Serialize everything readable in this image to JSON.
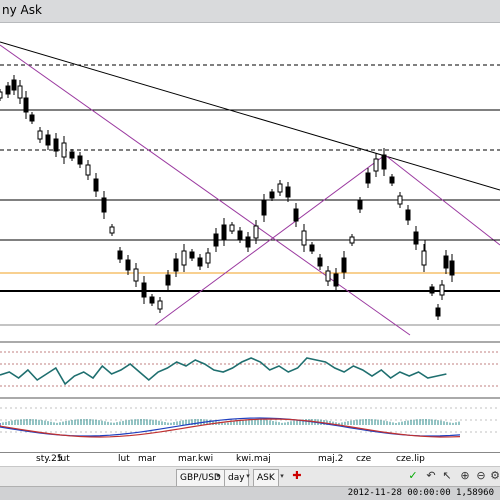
{
  "window": {
    "title": "ny Ask"
  },
  "chart": {
    "x_axis_labels": [
      "sty.25",
      "lut",
      "lut",
      "mar",
      "mar.kwi",
      "kwi.maj",
      "maj.2",
      "cze",
      "cze.lip"
    ],
    "colors": {
      "candle": "#000000",
      "trendline": "#000000",
      "channel": "#9b3aa0",
      "horizontal": "#000000",
      "orange_level": "#f0a020",
      "rsi": "#1f6f6f",
      "macd_a": "#1f3fbf",
      "macd_b": "#c03030"
    }
  },
  "toolbar": {
    "symbol": "GBP/USD",
    "interval": "day",
    "price_side": "ASK",
    "icons": [
      "marker-icon",
      "undo-icon",
      "zoom-in-icon",
      "zoom-out-icon",
      "settings-icon"
    ]
  },
  "status": {
    "text": "2012-11-28 00:00:00 1,58960"
  }
}
